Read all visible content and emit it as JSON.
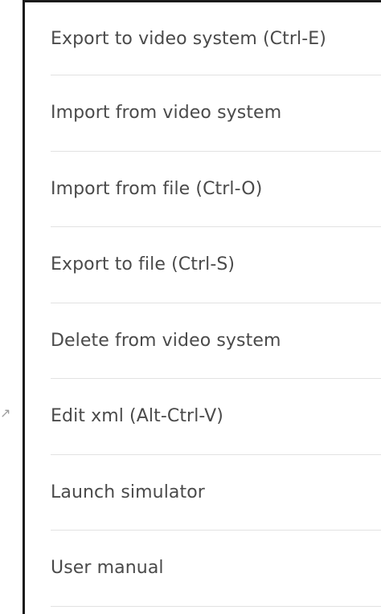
{
  "menu": {
    "items": [
      {
        "label": "Export to video system (Ctrl-E)"
      },
      {
        "label": "Import from video system"
      },
      {
        "label": "Import from file (Ctrl-O)"
      },
      {
        "label": "Export to file (Ctrl-S)"
      },
      {
        "label": "Delete from video system"
      },
      {
        "label": "Edit xml (Alt-Ctrl-V)"
      },
      {
        "label": "Launch simulator"
      },
      {
        "label": "User manual"
      }
    ]
  }
}
